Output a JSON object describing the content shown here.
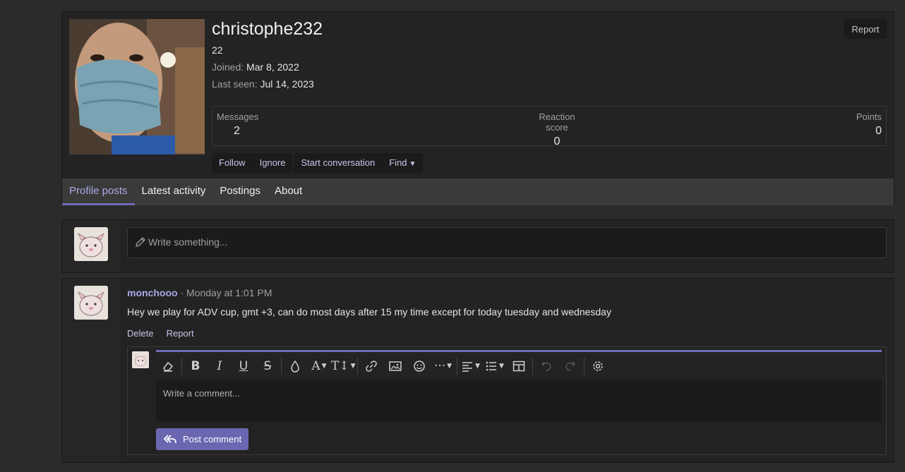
{
  "profile": {
    "username": "christophe232",
    "age": "22",
    "joined_label": "Joined:",
    "joined_value": "Mar 8, 2022",
    "lastseen_label": "Last seen:",
    "lastseen_value": "Jul 14, 2023",
    "report": "Report",
    "stats": {
      "messages_label": "Messages",
      "messages_value": "2",
      "reaction_label": "Reaction score",
      "reaction_value": "0",
      "points_label": "Points",
      "points_value": "0"
    },
    "actions": {
      "follow": "Follow",
      "ignore": "Ignore",
      "start_conversation": "Start conversation",
      "find": "Find"
    },
    "tabs": [
      "Profile posts",
      "Latest activity",
      "Postings",
      "About"
    ]
  },
  "write_box": {
    "placeholder": "Write something..."
  },
  "post": {
    "author": "monchooo",
    "meta": "· Monday at 1:01 PM",
    "body": "Hey we play for ADV cup, gmt +3, can do most days after 15 my time except for today tuesday and wednesday",
    "delete": "Delete",
    "report": "Report"
  },
  "comment": {
    "placeholder": "Write a comment...",
    "submit": "Post comment"
  },
  "colors": {
    "accent": "#6f6bb8",
    "link": "#c6c6ea",
    "bg": "#2b2b2b",
    "panel": "#232323"
  }
}
